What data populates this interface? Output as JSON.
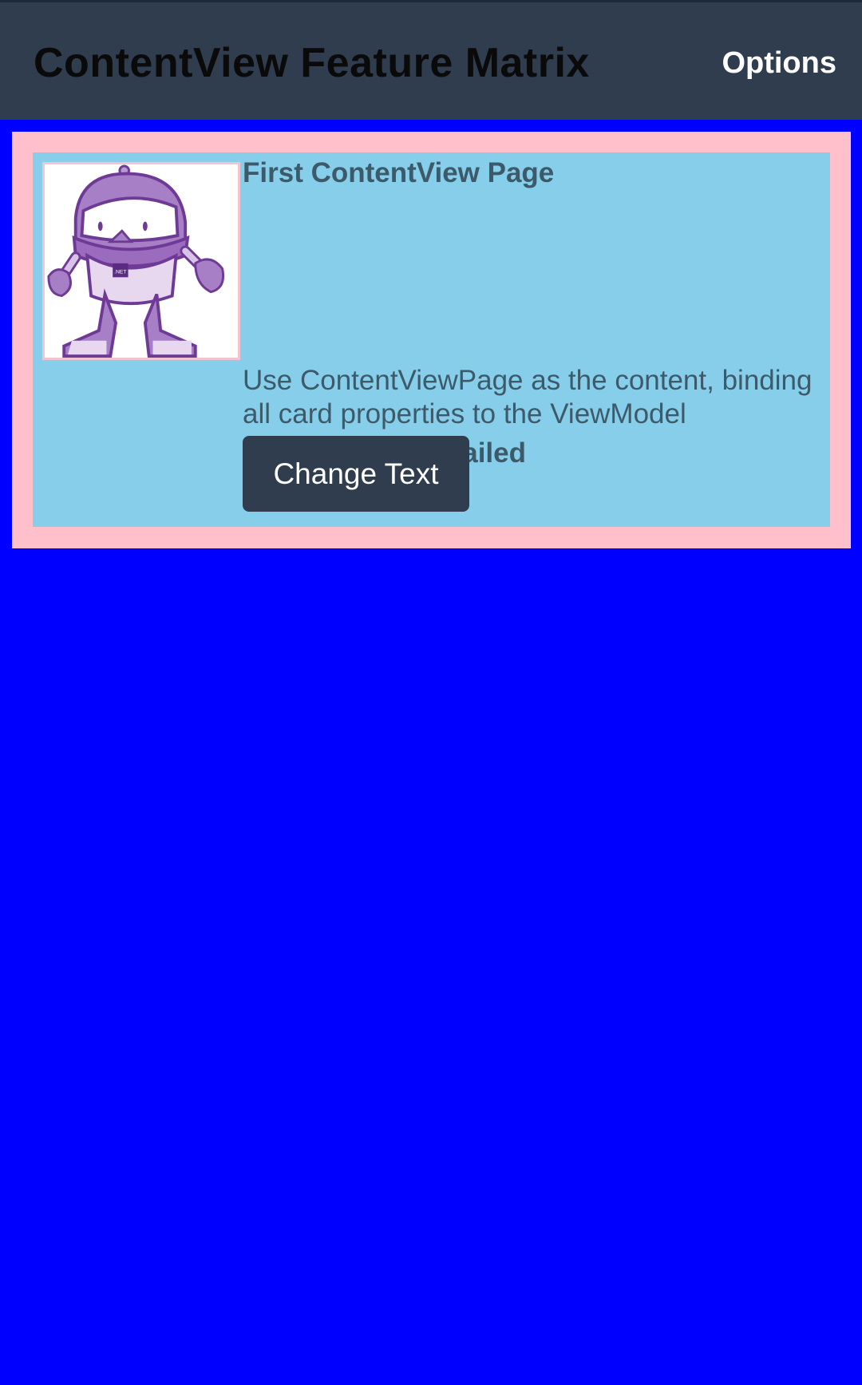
{
  "toolbar": {
    "title": "ContentView Feature Matrix",
    "options_label": "Options"
  },
  "card": {
    "title": "First ContentView Page",
    "description": "Use ContentViewPage as the content, binding all card properties to the ViewModel",
    "status": "Failed",
    "button_label": "Change Text",
    "image_badge_text": ".NET"
  },
  "colors": {
    "page_background": "#0000FF",
    "toolbar_background": "#2F3D4F",
    "card_border": "#FFC0CB",
    "card_background": "#87CEEB",
    "card_text": "#3D5A6A",
    "button_background": "#2F3D4F",
    "button_text": "#FFFFFF"
  },
  "icons": {
    "card_image": "dotnet-bot-robot-image"
  }
}
